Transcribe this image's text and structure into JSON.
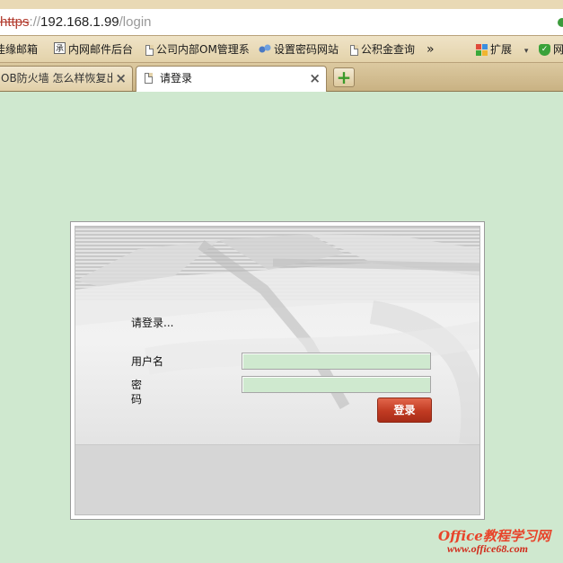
{
  "browser": {
    "url": {
      "protocol": "https",
      "separator": "://",
      "host": "192.168.1.99",
      "path": "/login"
    },
    "bookmarks": [
      {
        "label": "佳缘邮箱",
        "icon": "mail-icon"
      },
      {
        "label": "内网邮件后台",
        "icon": "site-favicon-icon"
      },
      {
        "label": "公司内部OM管理系",
        "icon": "document-icon"
      },
      {
        "label": "设置密码网站",
        "icon": "link-icon"
      },
      {
        "label": "公积金查询",
        "icon": "document-icon"
      }
    ],
    "overflow_label": "»",
    "extensions_label": "扩展",
    "extensions_arrow": "▾",
    "shield_label": "网",
    "tabs": [
      {
        "label": "OB防火墙 怎么样恢复出厂",
        "active": false
      },
      {
        "label": "请登录",
        "active": true
      }
    ],
    "close_glyph": "×",
    "new_tab_glyph": "+"
  },
  "login": {
    "prompt": "请登录...",
    "username_label": "用户名",
    "password_label_line1": "密",
    "password_label_line2": "码",
    "username_value": "",
    "password_value": "",
    "submit_label": "登录"
  },
  "watermark": {
    "line1": "Office教程学习网",
    "line2": "www.office68.com"
  },
  "colors": {
    "page_background": "#cfe8cf",
    "field_background": "#cfe9cf",
    "button_red": "#c03a22",
    "watermark_red": "#e8432a"
  }
}
